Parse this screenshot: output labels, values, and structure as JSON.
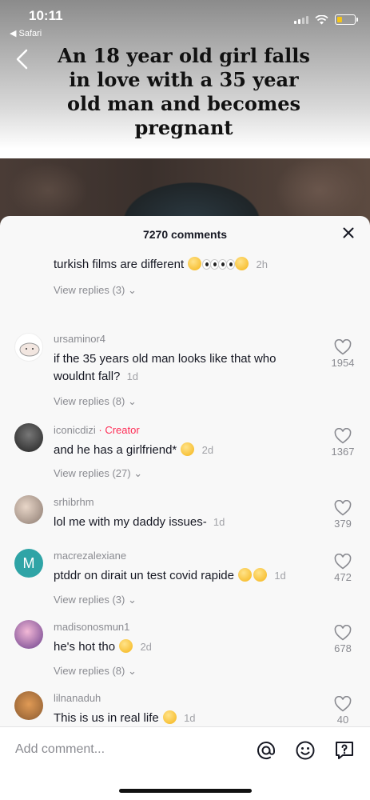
{
  "status": {
    "time": "10:11",
    "back_app": "◀ Safari"
  },
  "video": {
    "title": "An 18 year old girl falls in love with a 35 year old man and becomes pregnant"
  },
  "sheet": {
    "count_label": "7270 comments"
  },
  "comments": [
    {
      "user": "",
      "text": "turkish films are different",
      "date": "2h",
      "replies": "View replies (3)",
      "likes": ""
    },
    {
      "user": "ursaminor4",
      "text": "if the 35 years old man looks like that who wouldnt fall?",
      "date": "1d",
      "replies": "View replies (8)",
      "likes": "1954"
    },
    {
      "user": "iconicdizi",
      "badge": "· Creator",
      "text": "and he has a girlfriend*",
      "date": "2d",
      "replies": "View replies (27)",
      "likes": "1367"
    },
    {
      "user": "srhibrhm",
      "text": "lol me with my daddy issues-",
      "date": "1d",
      "replies": "",
      "likes": "379"
    },
    {
      "user": "macrezalexiane",
      "avatar_letter": "M",
      "text": "ptddr on dirait un test covid rapide",
      "date": "1d",
      "replies": "View replies (3)",
      "likes": "472"
    },
    {
      "user": "madisonosmun1",
      "text": "he's hot tho",
      "date": "2d",
      "replies": "View replies (8)",
      "likes": "678"
    },
    {
      "user": "lilnanaduh",
      "text": "This is us in real life",
      "date": "1d",
      "replies": "",
      "likes": "40"
    }
  ],
  "input": {
    "placeholder": "Add comment..."
  },
  "icons": {
    "back": "chevron-left-icon",
    "close": "close-icon",
    "like": "heart-icon",
    "mention": "at-icon",
    "emoji": "emoji-icon",
    "question": "question-icon"
  },
  "colors": {
    "creator": "#fe2c55",
    "avatar_m": "#2fa4a6"
  }
}
